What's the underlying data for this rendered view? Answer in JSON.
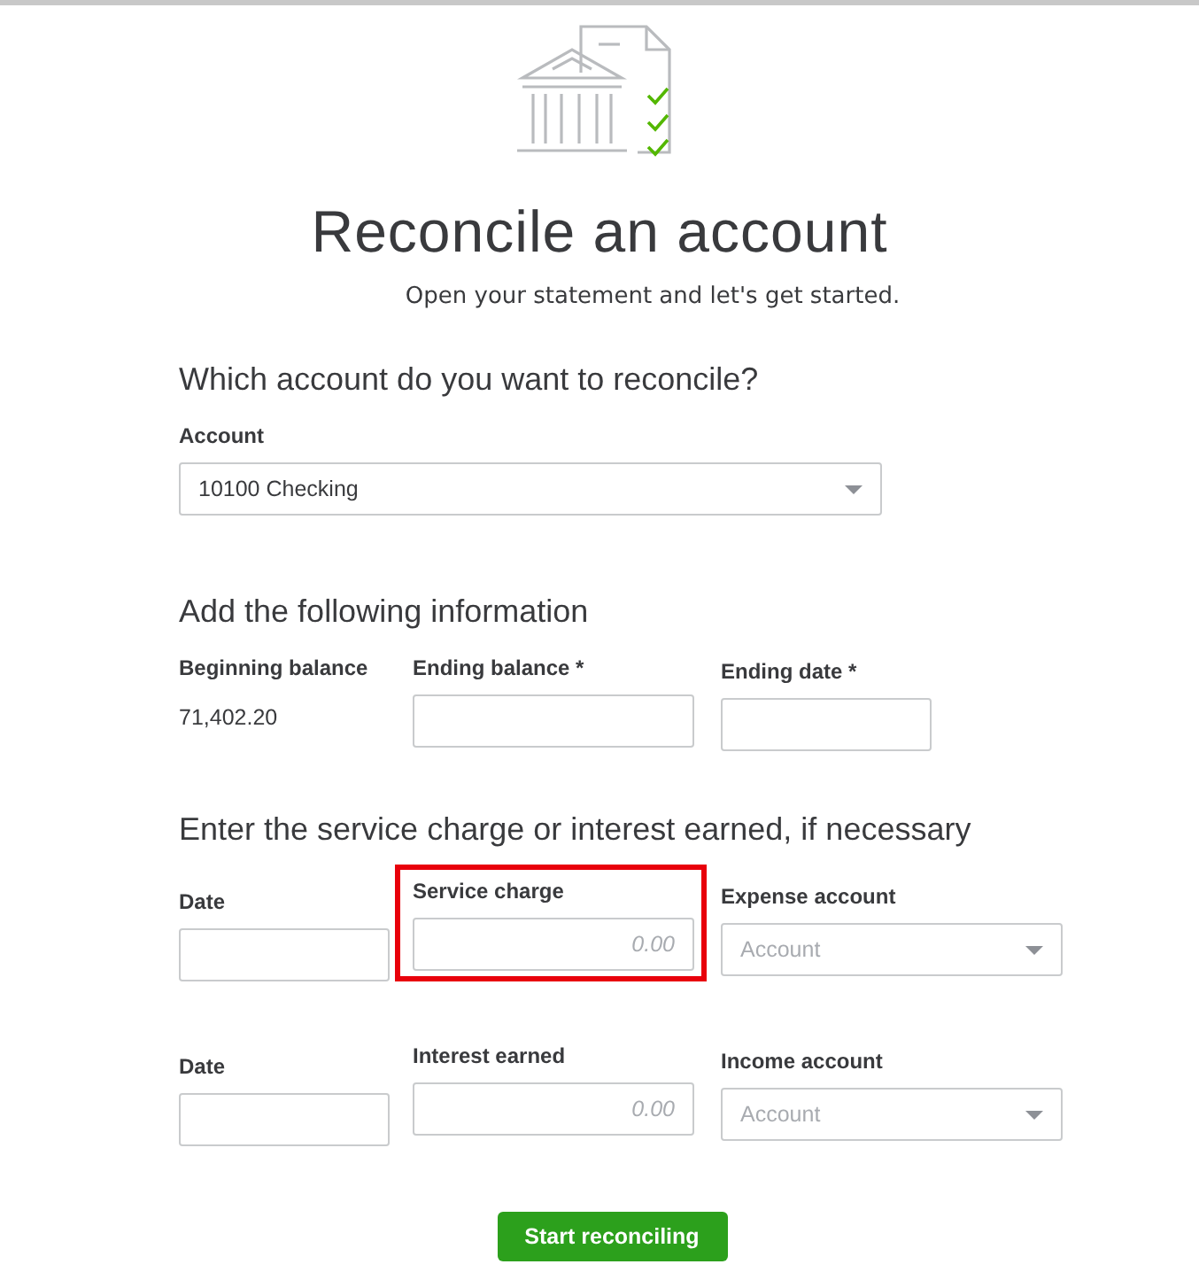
{
  "title": "Reconcile an account",
  "subtitle": "Open your statement and let's get started.",
  "account_section": {
    "heading": "Which account do you want to reconcile?",
    "label": "Account",
    "value": "10100 Checking"
  },
  "info_section": {
    "heading": "Add the following information",
    "beginning_balance": {
      "label": "Beginning balance",
      "value": "71,402.20"
    },
    "fields": [
      {
        "label": "Ending balance *"
      },
      {
        "label": "Ending date *"
      }
    ]
  },
  "charges_section": {
    "heading": "Enter the service charge or interest earned, if necessary",
    "rows": [
      {
        "date_label": "Date",
        "amount_label": "Service charge",
        "amount_placeholder": "0.00",
        "highlighted": true,
        "account_label": "Expense account",
        "account_placeholder": "Account"
      },
      {
        "date_label": "Date",
        "amount_label": "Interest earned",
        "amount_placeholder": "0.00",
        "highlighted": false,
        "account_label": "Income account",
        "account_placeholder": "Account"
      }
    ]
  },
  "button": "Start reconciling"
}
